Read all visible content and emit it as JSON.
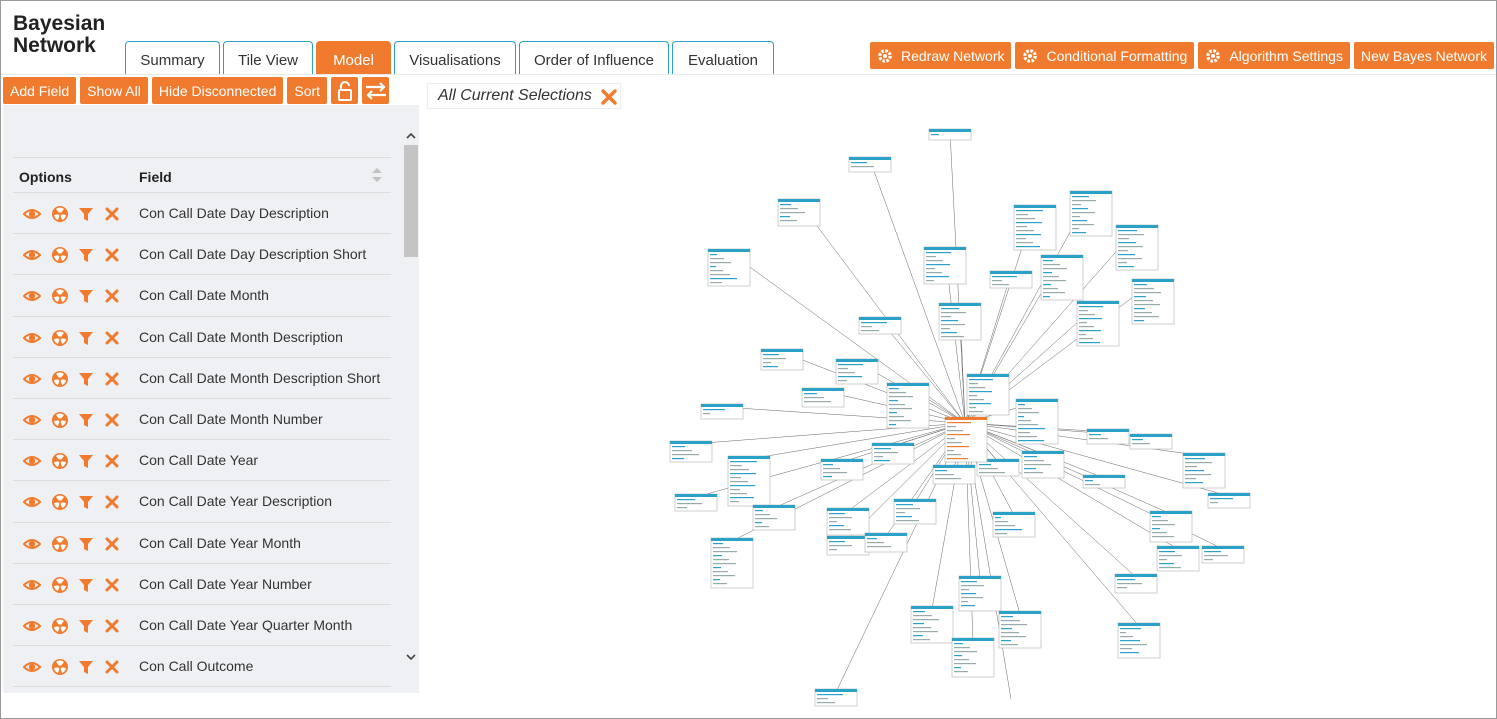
{
  "app": {
    "title_line1": "Bayesian",
    "title_line2": "Network"
  },
  "tabs": [
    {
      "label": "Summary",
      "active": false
    },
    {
      "label": "Tile View",
      "active": false
    },
    {
      "label": "Model",
      "active": true
    },
    {
      "label": "Visualisations",
      "active": false
    },
    {
      "label": "Order of Influence",
      "active": false
    },
    {
      "label": "Evaluation",
      "active": false
    }
  ],
  "actions": {
    "redraw": "Redraw Network",
    "conditional_formatting": "Conditional Formatting",
    "algorithm_settings": "Algorithm Settings",
    "new_bayes": "New Bayes Network"
  },
  "toolbar": {
    "add_field": "Add Field",
    "show_all": "Show All",
    "hide_disconnected": "Hide Disconnected",
    "sort": "Sort"
  },
  "selections": {
    "label": "All Current Selections"
  },
  "field_table": {
    "col_options": "Options",
    "col_field": "Field",
    "rows": [
      "Con Call Date Day Description",
      "Con Call Date Day Description Short",
      "Con Call Date Month",
      "Con Call Date Month Description",
      "Con Call Date Month Description Short",
      "Con Call Date Month Number",
      "Con Call Date Year",
      "Con Call Date Year Description",
      "Con Call Date Year Month",
      "Con Call Date Year Number",
      "Con Call Date Year Quarter Month",
      "Con Call Outcome"
    ]
  },
  "icons": {
    "eye": "eye-icon",
    "radiation": "radiation-icon",
    "filter": "filter-icon",
    "remove": "close-icon",
    "gear": "gear-icon",
    "lock": "lock-icon",
    "swap": "swap-arrows-icon",
    "sort": "sort-icon"
  },
  "colors": {
    "accent": "#f07b2e",
    "node_header": "#2aa2c8",
    "target_node": "#f07b2e"
  }
}
